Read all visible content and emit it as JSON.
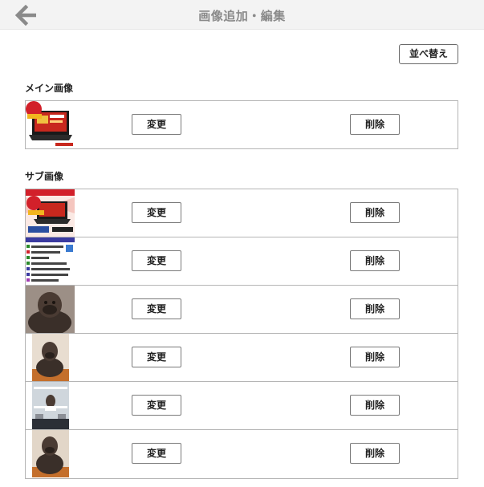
{
  "header": {
    "title": "画像追加・編集"
  },
  "toolbar": {
    "sort_label": "並べ替え"
  },
  "main_section": {
    "label": "メイン画像",
    "item": {
      "change_label": "変更",
      "delete_label": "削除"
    }
  },
  "sub_section": {
    "label": "サブ画像",
    "items": [
      {
        "change_label": "変更",
        "delete_label": "削除"
      },
      {
        "change_label": "変更",
        "delete_label": "削除"
      },
      {
        "change_label": "変更",
        "delete_label": "削除"
      },
      {
        "change_label": "変更",
        "delete_label": "削除"
      },
      {
        "change_label": "変更",
        "delete_label": "削除"
      },
      {
        "change_label": "変更",
        "delete_label": "削除"
      }
    ]
  },
  "colors": {
    "header_bg": "#f3f3f3",
    "title_text": "#8a8a8a",
    "border": "#b5b5b5",
    "back_arrow": "#8a8a8a"
  }
}
